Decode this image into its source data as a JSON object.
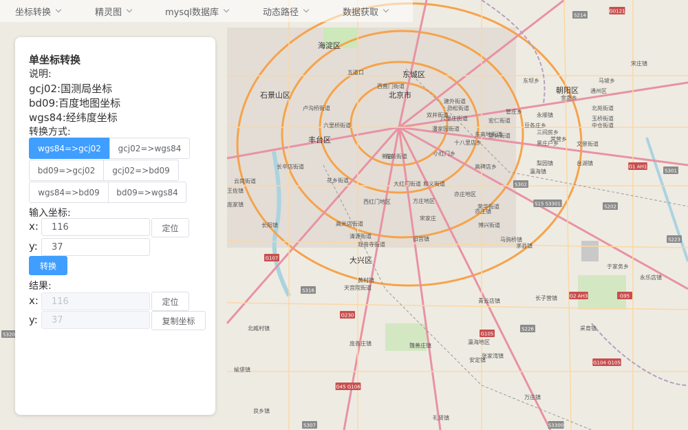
{
  "menu": [
    {
      "label": "坐标转换"
    },
    {
      "label": "精灵图"
    },
    {
      "label": "mysql数据库"
    },
    {
      "label": "动态路径"
    },
    {
      "label": "数据获取"
    }
  ],
  "panel": {
    "title": "单坐标转换",
    "desc_label": "说明:",
    "desc_lines": [
      "gcj02:国测局坐标",
      "bd09:百度地图坐标",
      "wgs84:经纬度坐标"
    ],
    "mode_label": "转换方式:",
    "modes": [
      "wgs84=>gcj02",
      "gcj02=>wgs84",
      "bd09=>gcj02",
      "gcj02=>bd09",
      "wgs84=>bd09",
      "bd09=>wgs84"
    ],
    "active_mode": "wgs84=>gcj02",
    "input_label": "输入坐标:",
    "x_label": "x:",
    "y_label": "y:",
    "input_x": "116",
    "input_y": "37",
    "locate_label": "定位",
    "convert_label": "转换",
    "result_label": "结果:",
    "result_x": "116",
    "result_y": "37",
    "copy_label": "复制坐标"
  },
  "map": {
    "district_labels": [
      "海淀区",
      "东城区",
      "北京市",
      "石景山区",
      "丰台区",
      "朝阳区",
      "通州区",
      "大兴区",
      "西红门地区",
      "亦庄地区",
      "马驹桥镇",
      "青云店镇",
      "采育镇",
      "礼贤镇",
      "万庄镇",
      "于家务乡",
      "永乐店镇",
      "宋庄镇",
      "台湖镇",
      "魏善庄镇",
      "庞各庄镇",
      "安定镇",
      "长子营镇",
      "黑庄户乡",
      "文景街道",
      "金盏乡",
      "豆各庄乡",
      "宏仁街道",
      "瀛海镇",
      "榆垡镇",
      "北臧村镇",
      "长阳镇",
      "良乡镇",
      "花乡街道",
      "卢沟桥街道",
      "长辛店街道",
      "云岗街道",
      "王佐镇",
      "庞家镇",
      "张家湾镇",
      "漷县镇",
      "马坡乡",
      "五道口",
      "西直门街道",
      "建外街道",
      "六里桥街道",
      "方庄地区",
      "宋家庄",
      "大红门街道",
      "南苑街道",
      "旧宫镇",
      "黄村镇",
      "天宫院街道",
      "高米店街道",
      "清源街道",
      "观音寺街道",
      "亦庄镇",
      "博兴街道",
      "荣华街道",
      "瀛海地区",
      "新宫",
      "和义街道",
      "东高地街道",
      "八里庄街道",
      "小红门乡",
      "十八里店乡",
      "垡头街道",
      "高碑店乡",
      "双井街道",
      "潘家园街道",
      "劲松街道",
      "东坝乡",
      "管庄乡",
      "三间房乡",
      "常营乡",
      "梨园镇",
      "永顺镇",
      "北苑街道",
      "玉桥街道",
      "中仓街道"
    ],
    "shields": [
      "S214",
      "G0121",
      "G1 AH1",
      "S301",
      "S15 S3301",
      "S202",
      "S302",
      "S223",
      "G107",
      "S316",
      "G230",
      "G105",
      "G45 G106",
      "G2 AH3",
      "G95",
      "G104 G105",
      "S226",
      "S3300",
      "S307",
      "S320"
    ],
    "road_color": "#f6a34a",
    "water_color": "#aad3df"
  }
}
